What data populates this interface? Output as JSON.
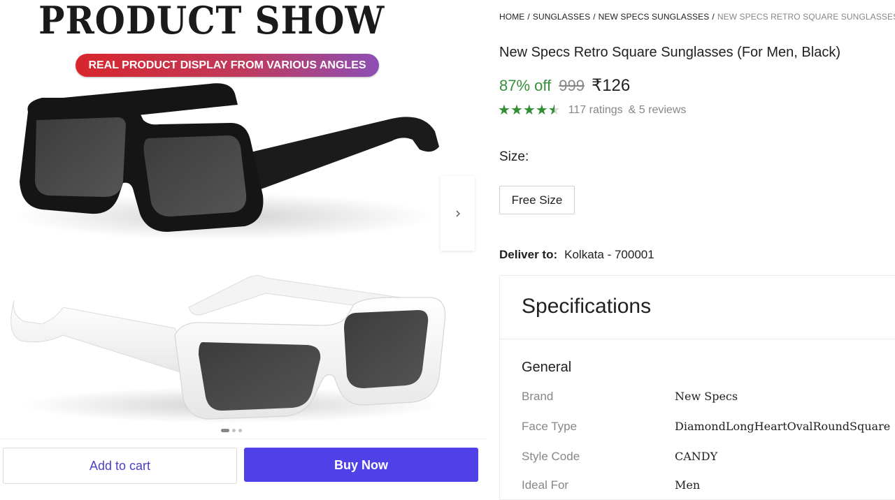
{
  "gallery": {
    "promo_title": "PRODUCT SHOW",
    "promo_subtitle": "REAL PRODUCT DISPLAY FROM VARIOUS ANGLES",
    "dots_active_index": 0,
    "dots_total": 3
  },
  "actions": {
    "add_to_cart": "Add to cart",
    "buy_now": "Buy Now"
  },
  "breadcrumb": {
    "items": [
      "HOME",
      "SUNGLASSES",
      "NEW SPECS SUNGLASSES"
    ],
    "separator": "/",
    "current": "NEW SPECS RETRO SQUARE SUNGLASSES"
  },
  "product": {
    "title": "New Specs Retro Square Sunglasses (For Men, Black)",
    "discount": "87% off",
    "mrp": "999",
    "price": "₹126",
    "rating_value": 4.5,
    "ratings": "117 ratings",
    "reviews": "& 5 reviews"
  },
  "size": {
    "label": "Size:",
    "selected": "Free Size"
  },
  "delivery": {
    "label": "Deliver to:",
    "location": "Kolkata - 700001"
  },
  "specifications": {
    "title": "Specifications",
    "section": "General",
    "rows": [
      {
        "key": "Brand",
        "value": "New Specs"
      },
      {
        "key": "Face Type",
        "value": "DiamondLongHeartOvalRoundSquare"
      },
      {
        "key": "Style Code",
        "value": "CANDY"
      },
      {
        "key": "Ideal For",
        "value": "Men"
      }
    ]
  },
  "colors": {
    "accent": "#4f40e8",
    "discount_green": "#388e3c",
    "star_green": "#2f8f32",
    "muted": "#878787"
  }
}
